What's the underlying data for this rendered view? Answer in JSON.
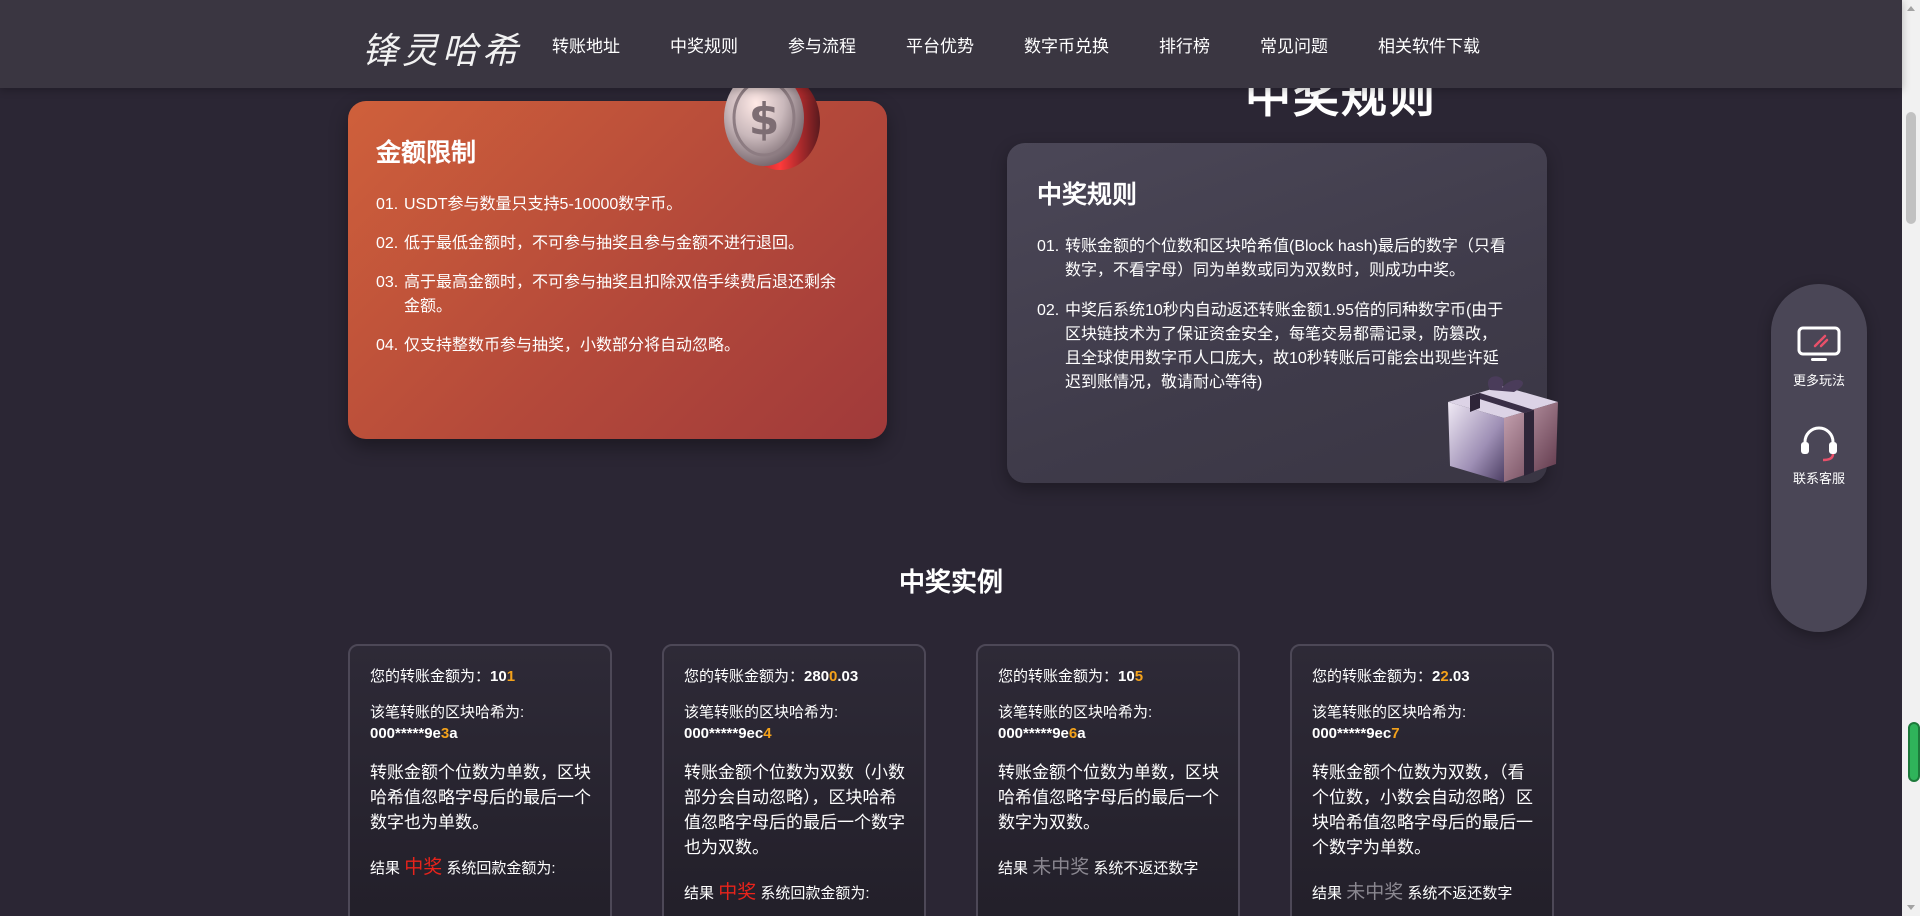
{
  "header": {
    "logo": "锋灵哈希",
    "nav": [
      "转账地址",
      "中奖规则",
      "参与流程",
      "平台优势",
      "数字币兑换",
      "排行榜",
      "常见问题",
      "相关软件下载"
    ]
  },
  "rules_section": {
    "title": "中奖规则"
  },
  "amount_limit": {
    "title": "金额限制",
    "items": [
      {
        "num": "01.",
        "text": "USDT参与数量只支持5-10000数字币。"
      },
      {
        "num": "02.",
        "text": "低于最低金额时，不可参与抽奖且参与金额不进行退回。"
      },
      {
        "num": "03.",
        "text": "高于最高金额时，不可参与抽奖且扣除双倍手续费后退还剩余金额。"
      },
      {
        "num": "04.",
        "text": "仅支持整数币参与抽奖，小数部分将自动忽略。"
      }
    ]
  },
  "win_rules": {
    "title": "中奖规则",
    "items": [
      {
        "num": "01.",
        "text": "转账金额的个位数和区块哈希值(Block hash)最后的数字（只看数字，不看字母）同为单数或同为双数时，则成功中奖。"
      },
      {
        "num": "02.",
        "text": "中奖后系统10秒内自动返还转账金额1.95倍的同种数字币(由于区块链技术为了保证资金安全，每笔交易都需记录，防篡改，且全球使用数字币人口庞大，故10秒转账后可能会出现些许延迟到账情况，敬请耐心等待)"
      }
    ]
  },
  "side_panel": {
    "more_play": "更多玩法",
    "contact": "联系客服"
  },
  "examples": {
    "title": "中奖实例",
    "amount_label": "您的转账金额为：",
    "hash_label": "该笔转账的区块哈希为:",
    "result_prefix": "结果",
    "cards": [
      {
        "amount_pre": "10",
        "amount_hl": "1",
        "amount_post": "",
        "hash_pre": "000*****9e",
        "hash_hl": "3",
        "hash_post": "a",
        "desc": "转账金额个位数为单数，区块哈希值忽略字母后的最后一个数字也为单数。",
        "status": "中奖",
        "status_type": "win",
        "result_text": "系统回款金额为:"
      },
      {
        "amount_pre": "280",
        "amount_hl": "0",
        "amount_post": ".03",
        "hash_pre": "000*****9ec",
        "hash_hl": "4",
        "hash_post": "",
        "desc": "转账金额个位数为双数（小数部分会自动忽略），区块哈希值忽略字母后的最后一个数字也为双数。",
        "status": "中奖",
        "status_type": "win",
        "result_text": "系统回款金额为:"
      },
      {
        "amount_pre": "10",
        "amount_hl": "5",
        "amount_post": "",
        "hash_pre": "000*****9e",
        "hash_hl": "6",
        "hash_post": "a",
        "desc": "转账金额个位数为单数，区块哈希值忽略字母后的最后一个数字为双数。",
        "status": "未中奖",
        "status_type": "lose",
        "result_text": "系统不返还数字"
      },
      {
        "amount_pre": "2",
        "amount_hl": "2",
        "amount_post": ".03",
        "hash_pre": "000*****9ec",
        "hash_hl": "7",
        "hash_post": "",
        "desc": "转账金额个位数为双数，（看个位数，小数会自动忽略）区块哈希值忽略字母后的最后一个数字为单数。",
        "status": "未中奖",
        "status_type": "lose",
        "result_text": "系统不返还数字"
      }
    ]
  }
}
